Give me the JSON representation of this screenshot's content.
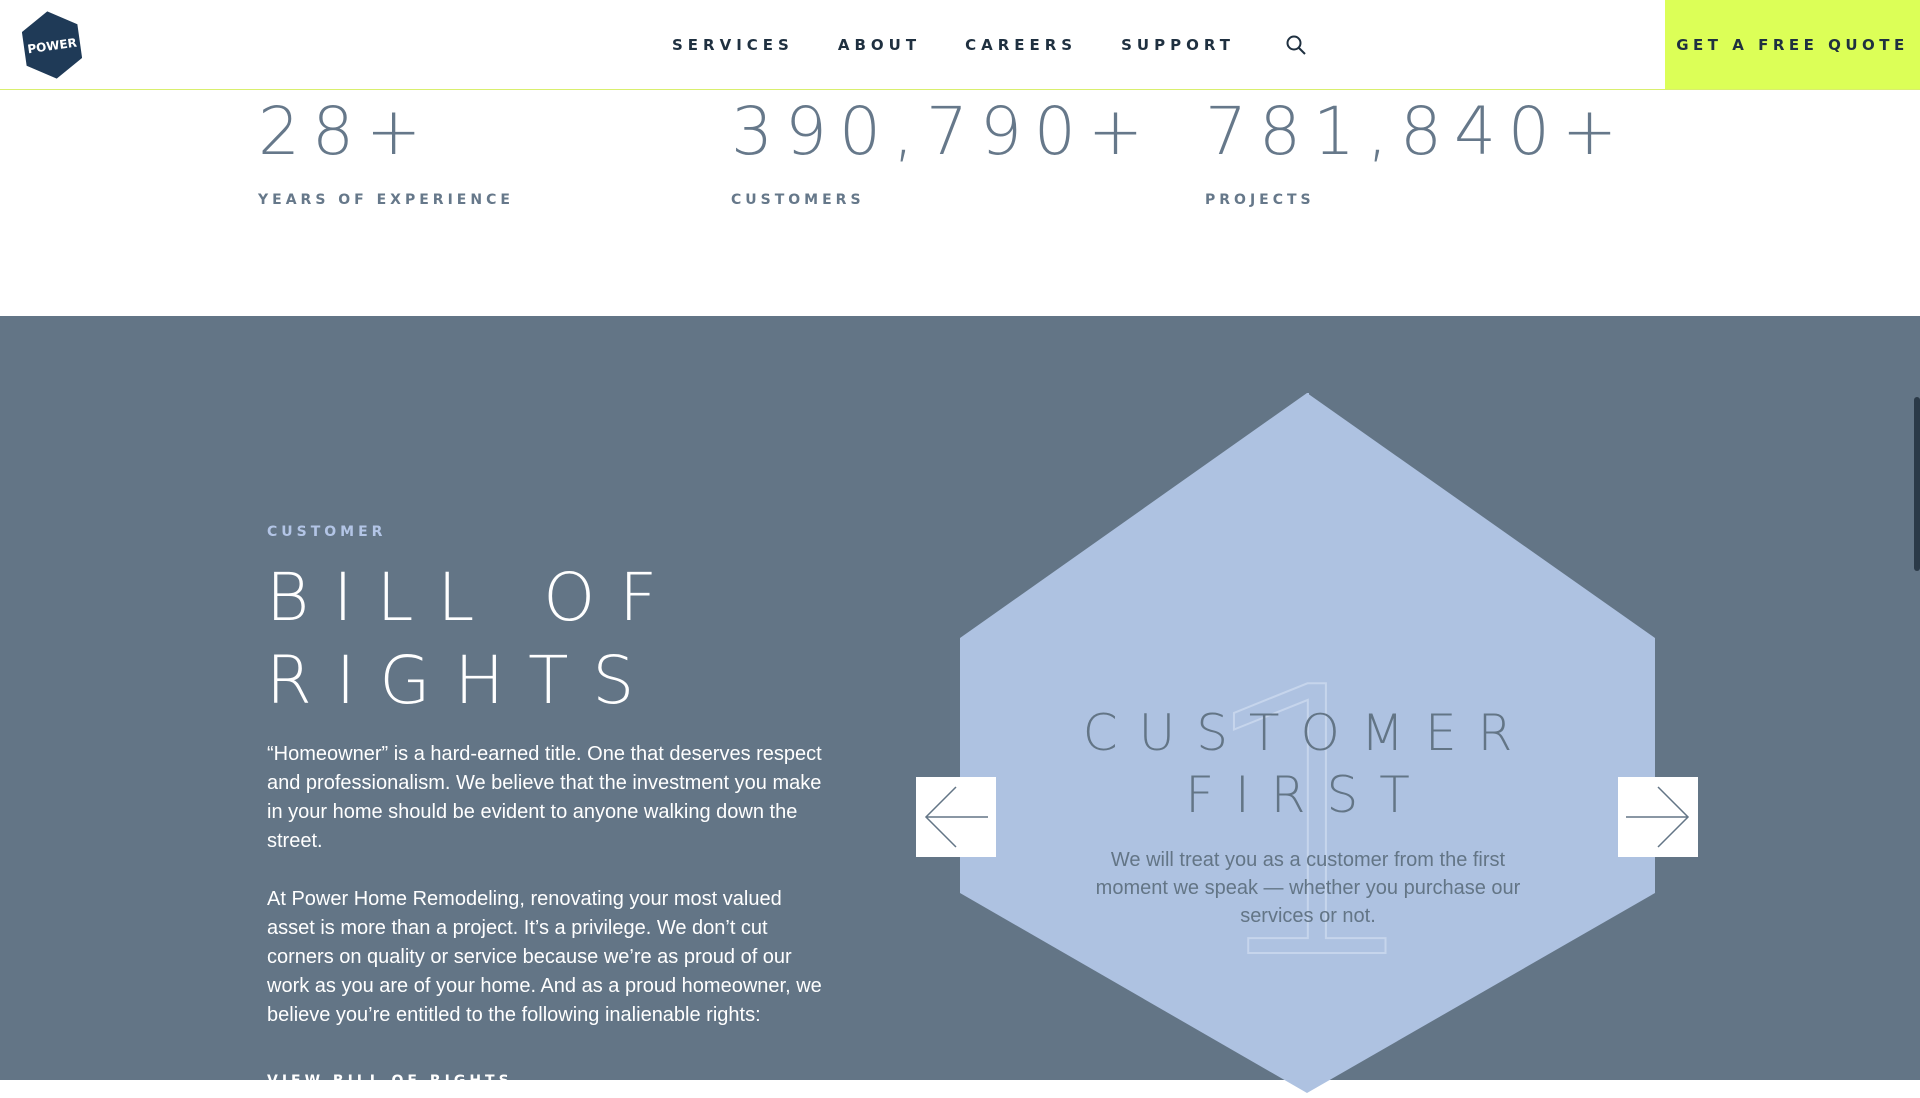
{
  "header": {
    "logo_text": "POWER",
    "nav": [
      "SERVICES",
      "ABOUT",
      "CAREERS",
      "SUPPORT"
    ],
    "search_icon": "search-icon",
    "cta_label": "GET A FREE QUOTE"
  },
  "stats": [
    {
      "value": "28+",
      "label": "YEARS OF EXPERIENCE"
    },
    {
      "value": "390,790+",
      "label": "CUSTOMERS"
    },
    {
      "value": "781,840+",
      "label": "PROJECTS"
    }
  ],
  "section": {
    "eyebrow": "CUSTOMER",
    "title_line1": "BILL OF",
    "title_line2": "RIGHTS",
    "paragraph1": "“Homeowner” is a hard-earned title. One that deserves respect and professionalism. We believe that the investment you make in your home should be evident to anyone walking down the street.",
    "paragraph2": "At Power Home Remodeling, renovating your most valued asset is more than a project. It’s a privilege. We don’t cut corners on quality or service because we’re as proud of our work as you are of your home. And as a proud homeowner, we believe you’re entitled to the following inalienable rights:",
    "link_label": "VIEW BILL OF RIGHTS"
  },
  "carousel": {
    "slide_number": "1",
    "slide_title_line1": "CUSTOMER",
    "slide_title_line2": "FIRST",
    "slide_text": "We will treat you as a customer from the first moment we speak — whether you purchase our services or not.",
    "prev_icon": "arrow-left-icon",
    "next_icon": "arrow-right-icon"
  },
  "colors": {
    "accent": "#dcff57",
    "band": "#637586",
    "hexagon": "#aec2e1",
    "text_dark": "#1f3040"
  }
}
